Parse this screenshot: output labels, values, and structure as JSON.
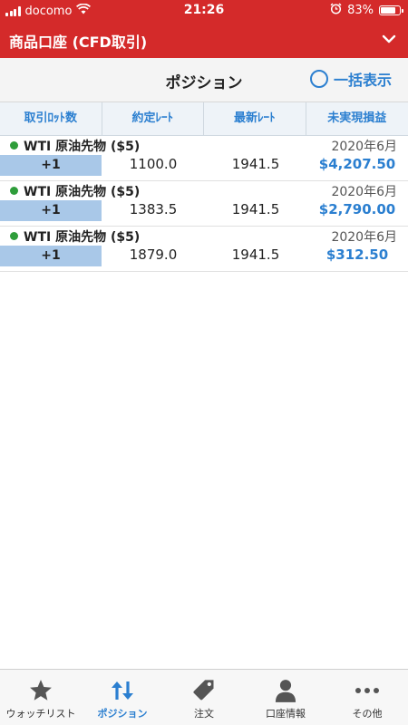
{
  "status": {
    "carrier": "docomo",
    "time": "21:26",
    "battery": "83%",
    "battery_level": 0.83
  },
  "header": {
    "title": "商品口座 (CFD取引)"
  },
  "nav": {
    "title": "ポジション",
    "bulk_label": "一括表示"
  },
  "columns": [
    "取引ﾛｯﾄ数",
    "約定ﾚｰﾄ",
    "最新ﾚｰﾄ",
    "未実現損益"
  ],
  "positions": [
    {
      "name": "WTI 原油先物 ($5)",
      "month": "2020年6月",
      "qty": "+1",
      "contract_rate": "1100.0",
      "latest_rate": "1941.5",
      "pl": "$4,207.50"
    },
    {
      "name": "WTI 原油先物 ($5)",
      "month": "2020年6月",
      "qty": "+1",
      "contract_rate": "1383.5",
      "latest_rate": "1941.5",
      "pl": "$2,790.00"
    },
    {
      "name": "WTI 原油先物 ($5)",
      "month": "2020年6月",
      "qty": "+1",
      "contract_rate": "1879.0",
      "latest_rate": "1941.5",
      "pl": "$312.50"
    }
  ],
  "tabs": [
    {
      "label": "ウォッチリスト",
      "icon": "star-icon"
    },
    {
      "label": "ポジション",
      "icon": "arrows-updown-icon",
      "active": true
    },
    {
      "label": "注文",
      "icon": "tag-icon"
    },
    {
      "label": "口座情報",
      "icon": "person-icon"
    },
    {
      "label": "その他",
      "icon": "more-icon"
    }
  ],
  "colors": {
    "brand_red": "#d42a2a",
    "accent_blue": "#2b7fd0",
    "qty_bg": "#a9c8e8",
    "dot_green": "#2e9d3a"
  }
}
